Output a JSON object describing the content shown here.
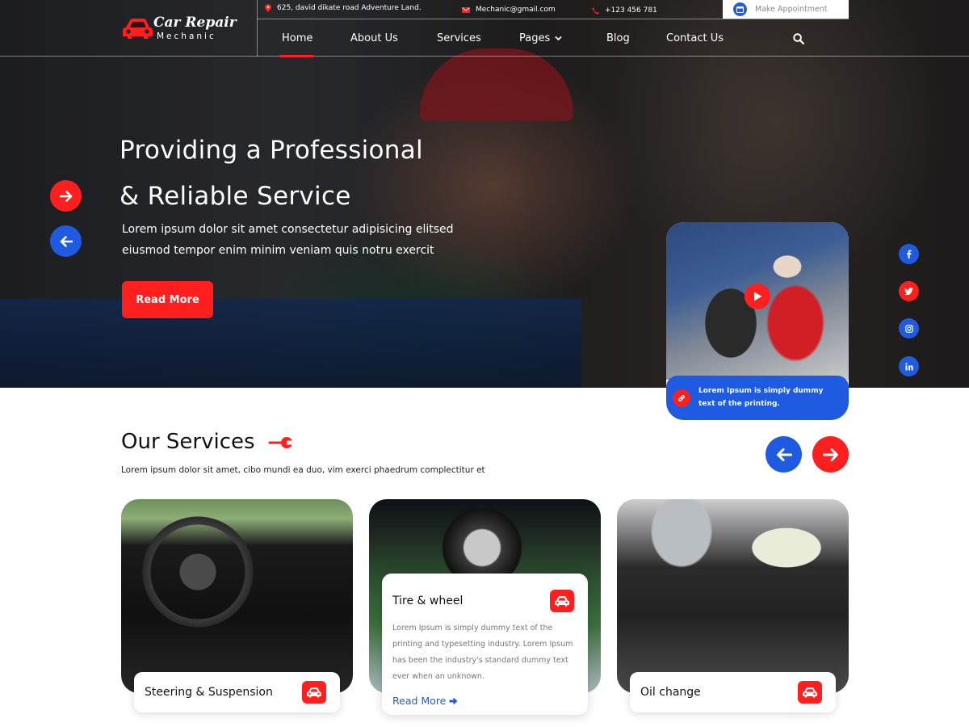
{
  "brand": {
    "title": "Car Repair",
    "subtitle": "Mechanic"
  },
  "topbar": {
    "address": "625, david dikate road Adventure Land.",
    "email": "Mechanic@gmail.com",
    "phone": "+123 456 781",
    "appointment_label": "Make Appointment"
  },
  "nav": {
    "items": [
      "Home",
      "About Us",
      "Services",
      "Pages",
      "Blog",
      "Contact Us"
    ],
    "active": "Home"
  },
  "hero": {
    "headline_line1": "Providing a Professional",
    "headline_line2": "& Reliable Service",
    "text_line1": "Lorem ipsum dolor sit amet consectetur adipisicing elitsed",
    "text_line2": "eiusmod tempor enim minim veniam quis notru exercit",
    "button": "Read More"
  },
  "video_card": {
    "caption": "Lorem Ipsum is simply dummy text of the printing."
  },
  "social": [
    "facebook-icon",
    "twitter-icon",
    "instagram-icon",
    "linkedin-icon"
  ],
  "services": {
    "title": "Our Services",
    "subtitle": "Lorem ipsum dolor sit amet, cibo mundi ea duo, vim exerci phaedrum complectitur et",
    "cards": [
      {
        "title": "Steering & Suspension"
      },
      {
        "title": "Tire & wheel",
        "text": "Lorem Ipsum is simply dummy text of the printing and typesetting industry. Lorem Ipsum has been the industry's standard dummy text ever when an unknown.",
        "link": "Read More"
      },
      {
        "title": "Oil change"
      }
    ]
  },
  "colors": {
    "accent_red": "#ff1f1f",
    "accent_blue": "#1f5be0"
  }
}
